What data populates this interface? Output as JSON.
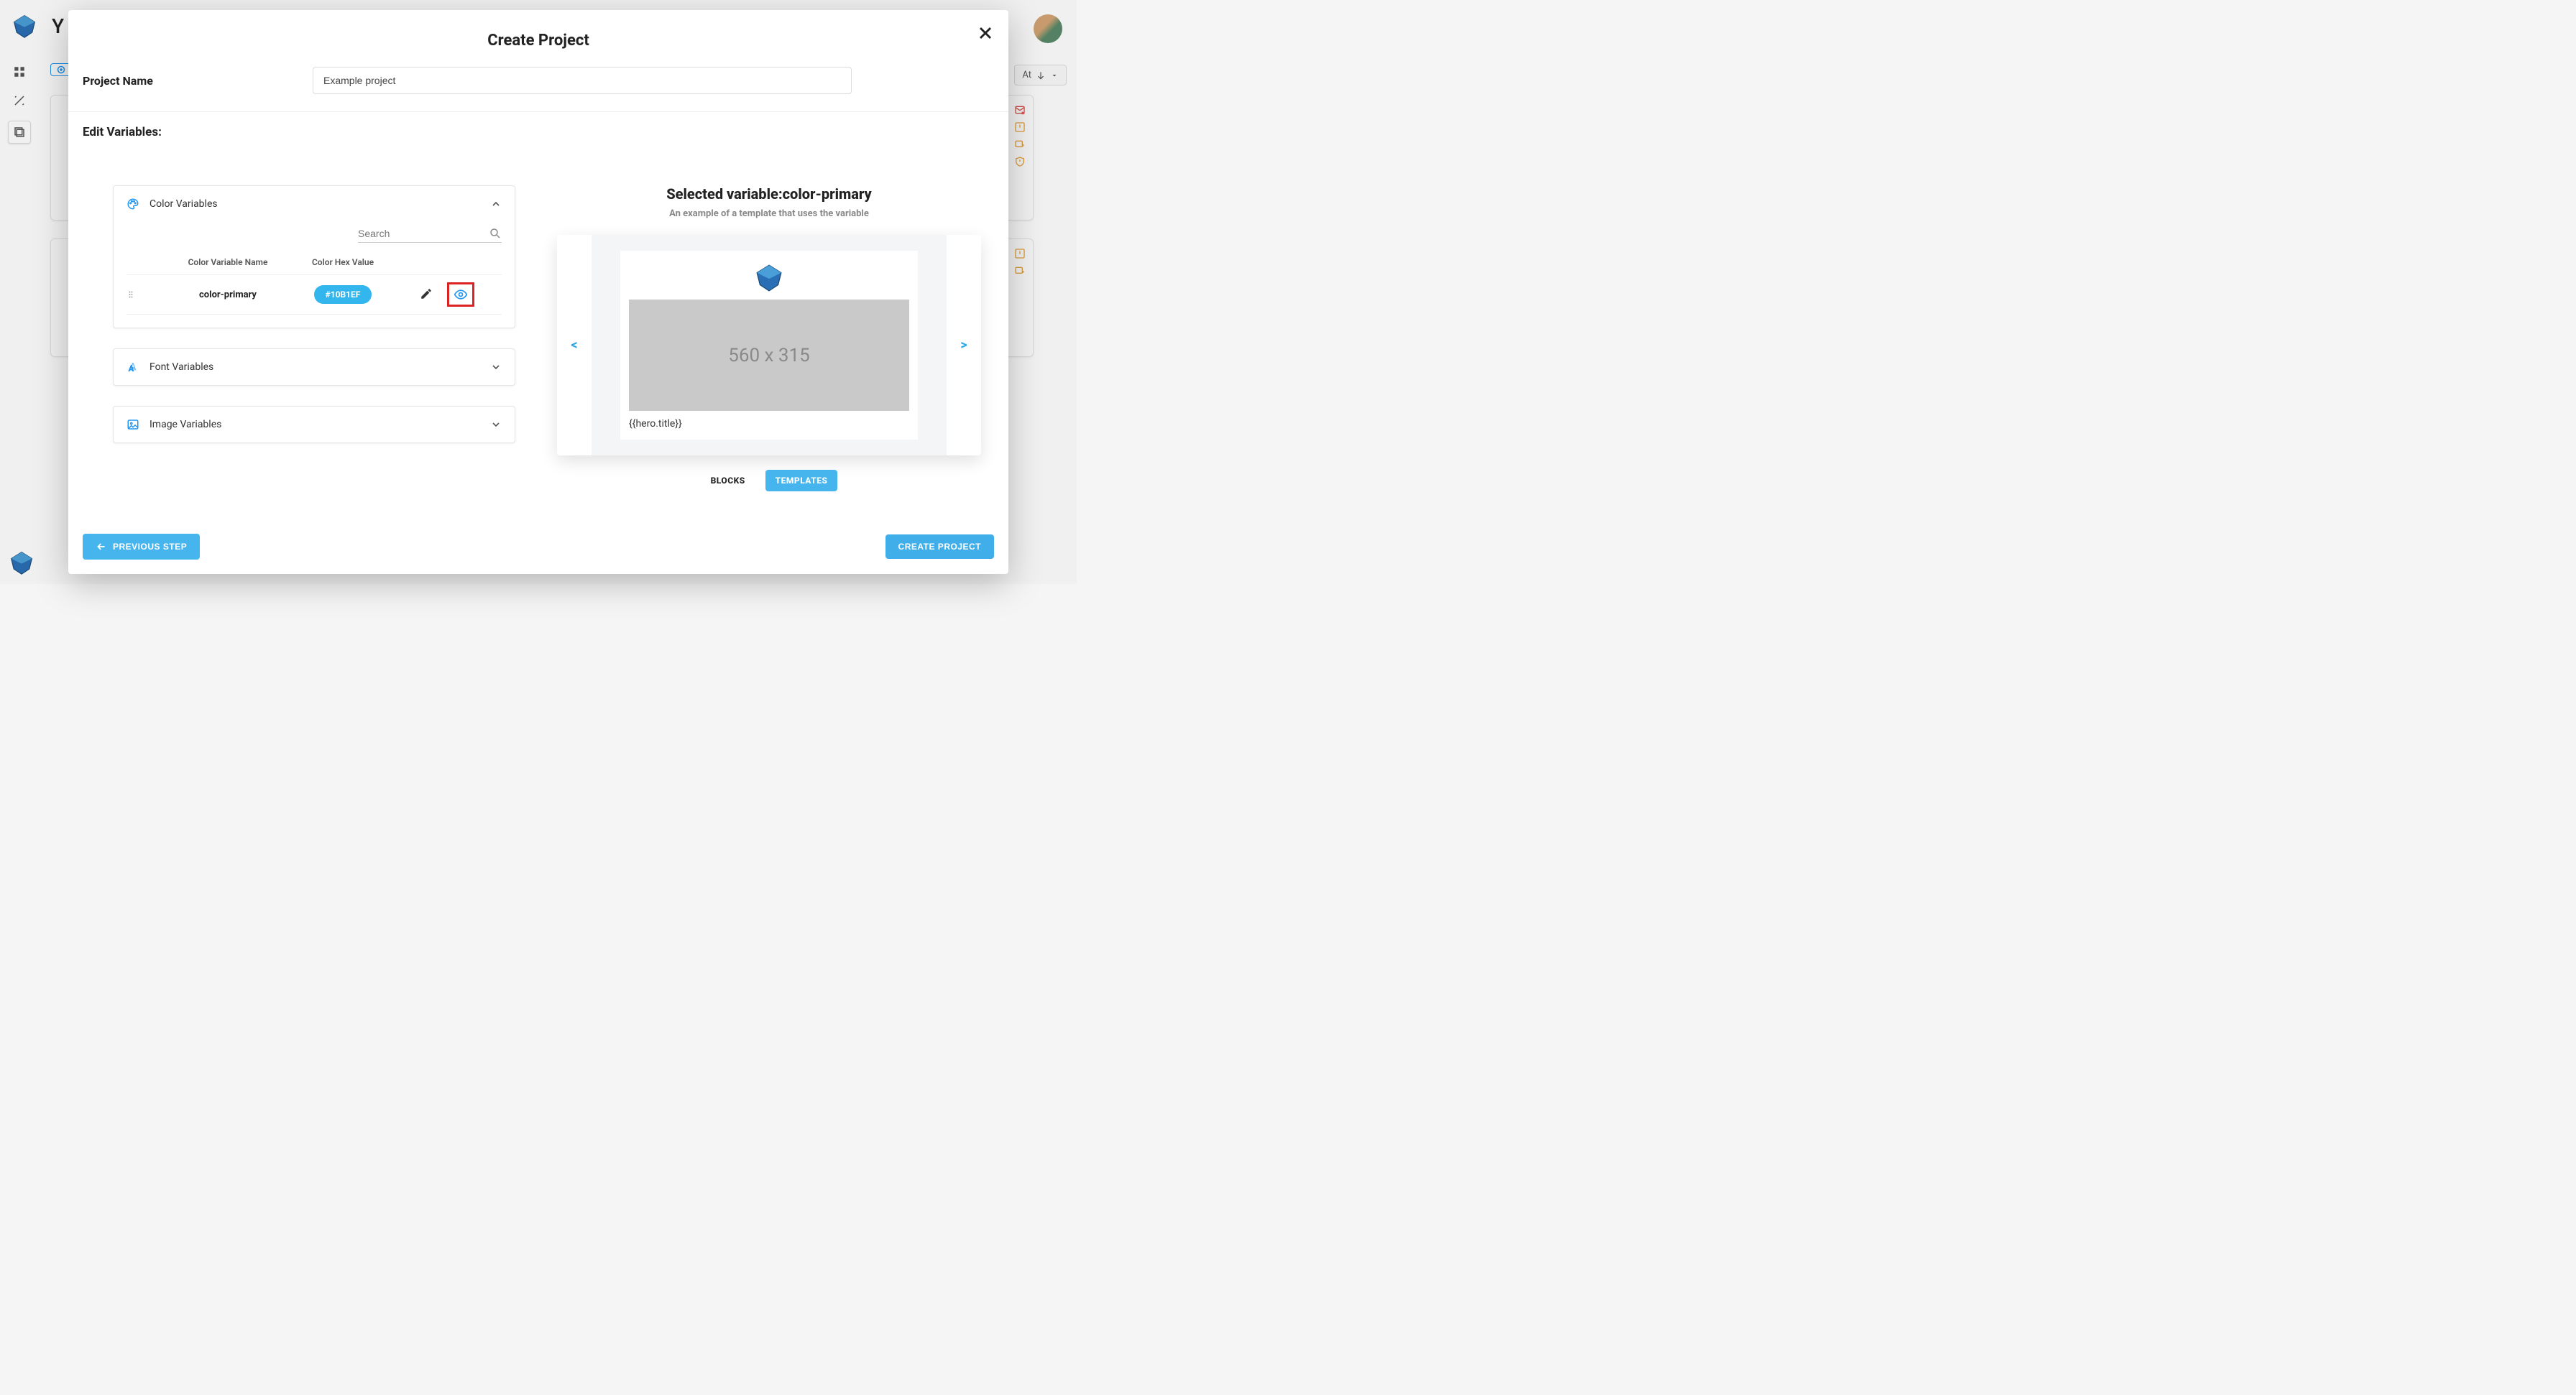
{
  "bg": {
    "pageTitleFirstLetter": "Y",
    "sortLabel": "At",
    "alertColors": {
      "red": "#d9534f",
      "orange": "#e8a33d"
    }
  },
  "modal": {
    "title": "Create Project",
    "projectNameLabel": "Project Name",
    "projectNameValue": "Example project",
    "editVariablesLabel": "Edit Variables:",
    "accordions": {
      "color": {
        "label": "Color Variables",
        "expanded": true
      },
      "font": {
        "label": "Font Variables",
        "expanded": false
      },
      "image": {
        "label": "Image Variables",
        "expanded": false
      }
    },
    "searchPlaceholder": "Search",
    "table": {
      "colName": "Color Variable Name",
      "colHex": "Color Hex Value",
      "rows": [
        {
          "name": "color-primary",
          "hex": "#10B1EF"
        }
      ]
    },
    "selected": {
      "label": "Selected variable:",
      "value": "color-primary",
      "sub": "An example of a template that uses the variable"
    },
    "preview": {
      "navPrev": "<",
      "navNext": ">",
      "placeholder": "560 x 315",
      "heroTitle": "{{hero.title}}"
    },
    "tabs": {
      "blocks": "BLOCKS",
      "templates": "TEMPLATES"
    },
    "footer": {
      "prev": "PREVIOUS STEP",
      "create": "CREATE PROJECT"
    }
  }
}
